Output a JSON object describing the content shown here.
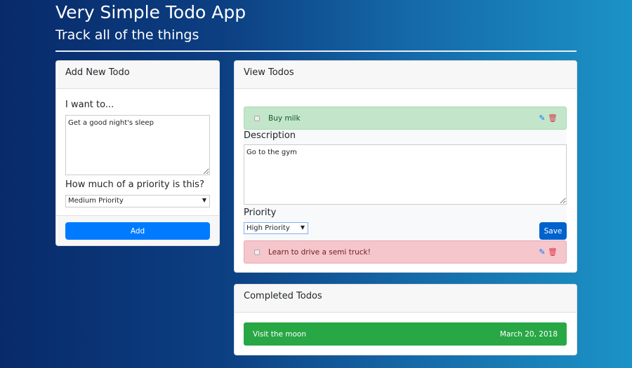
{
  "header": {
    "title": "Very Simple Todo App",
    "subtitle": "Track all of the things"
  },
  "add_card": {
    "title": "Add New Todo",
    "want_label": "I want to...",
    "want_value": "Get a good night's sleep",
    "priority_label": "How much of a priority is this?",
    "priority_value": "Medium Priority",
    "add_label": "Add"
  },
  "view_card": {
    "title": "View Todos",
    "items": [
      {
        "text": "Buy milk",
        "color": "#c3e6cb"
      },
      {
        "text": "Learn to drive a semi truck!",
        "color": "#f5c6cb"
      }
    ],
    "edit": {
      "description_label": "Description",
      "description_value": "Go to the gym",
      "priority_label": "Priority",
      "priority_value": "High Priority",
      "save_label": "Save"
    },
    "icons": {
      "edit": "✎",
      "delete": "🗑"
    }
  },
  "completed_card": {
    "title": "Completed Todos",
    "items": [
      {
        "text": "Visit the moon",
        "date": "March 20, 2018",
        "color": "#28a745"
      }
    ]
  },
  "colors": {
    "primary": "#007bff",
    "save": "#0062cc"
  }
}
